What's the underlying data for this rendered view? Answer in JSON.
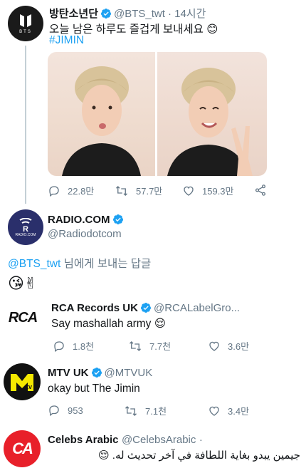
{
  "colors": {
    "accent": "#1da1f2",
    "text": "#14171a",
    "muted": "#657786",
    "verified": "#1da1f2",
    "mtv_yellow": "#f5e900",
    "radio_bg": "#2a2f6b",
    "celebs_red": "#e8202a"
  },
  "tweet1": {
    "name": "방탄소년단",
    "handle": "@BTS_twt",
    "time": "· 14시간",
    "text": "오늘 남은 하루도 즐겁게 보내세요 😊",
    "hashtag": "#JIMIN",
    "avatar_text": "BTS",
    "actions": {
      "replies": "22.8만",
      "retweets": "57.7만",
      "likes": "159.3만"
    }
  },
  "tweet2": {
    "name": "RADIO.COM",
    "handle": "@Radiodotcom",
    "avatar_text": "RADIO.COM",
    "reply_prefix": "@BTS_twt",
    "reply_suffix": " 님에게 보내는 답글",
    "text": "😘✌"
  },
  "tweet3": {
    "name": "RCA Records UK",
    "handle": "@RCALabelGro...",
    "text": "Say mashallah army 😌",
    "avatar_text": "RCA",
    "actions": {
      "replies": "1.8천",
      "retweets": "7.7천",
      "likes": "3.6만"
    }
  },
  "tweet4": {
    "name": "MTV UK",
    "handle": "@MTVUK",
    "text": "okay but The Jimin",
    "actions": {
      "replies": "953",
      "retweets": "7.1천",
      "likes": "3.4만"
    }
  },
  "tweet5": {
    "name": "Celebs Arabic",
    "handle": "@CelebsArabic",
    "dot": "·",
    "text": "جيمين يبدو بغاية اللطافة في آخر تحديث له. 😌",
    "avatar_text": "CA"
  }
}
